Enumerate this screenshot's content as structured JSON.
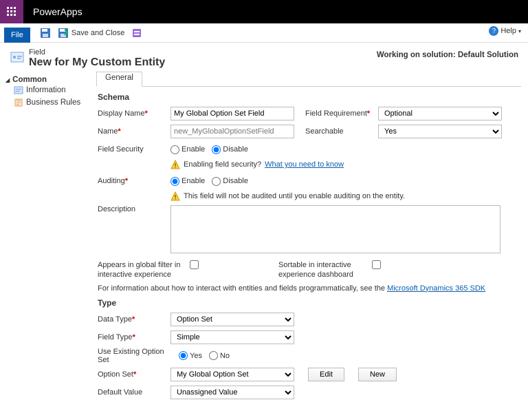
{
  "top": {
    "brand": "PowerApps"
  },
  "ribbon": {
    "file": "File",
    "save_close": "Save and Close",
    "help": "Help"
  },
  "header": {
    "small": "Field",
    "big": "New for My Custom Entity",
    "right": "Working on solution: Default Solution"
  },
  "sidebar": {
    "group": "Common",
    "info": "Information",
    "rules": "Business Rules"
  },
  "tabs": {
    "general": "General"
  },
  "schema": {
    "heading": "Schema",
    "display_name_lbl": "Display Name",
    "display_name": "My Global Option Set Field",
    "field_req_lbl": "Field Requirement",
    "field_req": "Optional",
    "name_lbl": "Name",
    "name_value": "new_MyGlobalOptionSetField",
    "searchable_lbl": "Searchable",
    "searchable": "Yes",
    "field_sec_lbl": "Field Security",
    "enable": "Enable",
    "disable": "Disable",
    "sec_warn": "Enabling field security?",
    "sec_link": "What you need to know",
    "auditing_lbl": "Auditing",
    "audit_warn": "This field will not be audited until you enable auditing on the entity.",
    "desc_lbl": "Description",
    "global_filter_lbl": "Appears in global filter in interactive experience",
    "sortable_lbl": "Sortable in interactive experience dashboard",
    "info_prefix": "For information about how to interact with entities and fields programmatically, see the ",
    "info_link": "Microsoft Dynamics 365 SDK"
  },
  "type": {
    "heading": "Type",
    "data_type_lbl": "Data Type",
    "data_type": "Option Set",
    "field_type_lbl": "Field Type",
    "field_type": "Simple",
    "use_existing_lbl": "Use Existing Option Set",
    "yes": "Yes",
    "no": "No",
    "option_set_lbl": "Option Set",
    "option_set": "My Global Option Set",
    "edit": "Edit",
    "new": "New",
    "default_lbl": "Default Value",
    "default": "Unassigned Value"
  }
}
